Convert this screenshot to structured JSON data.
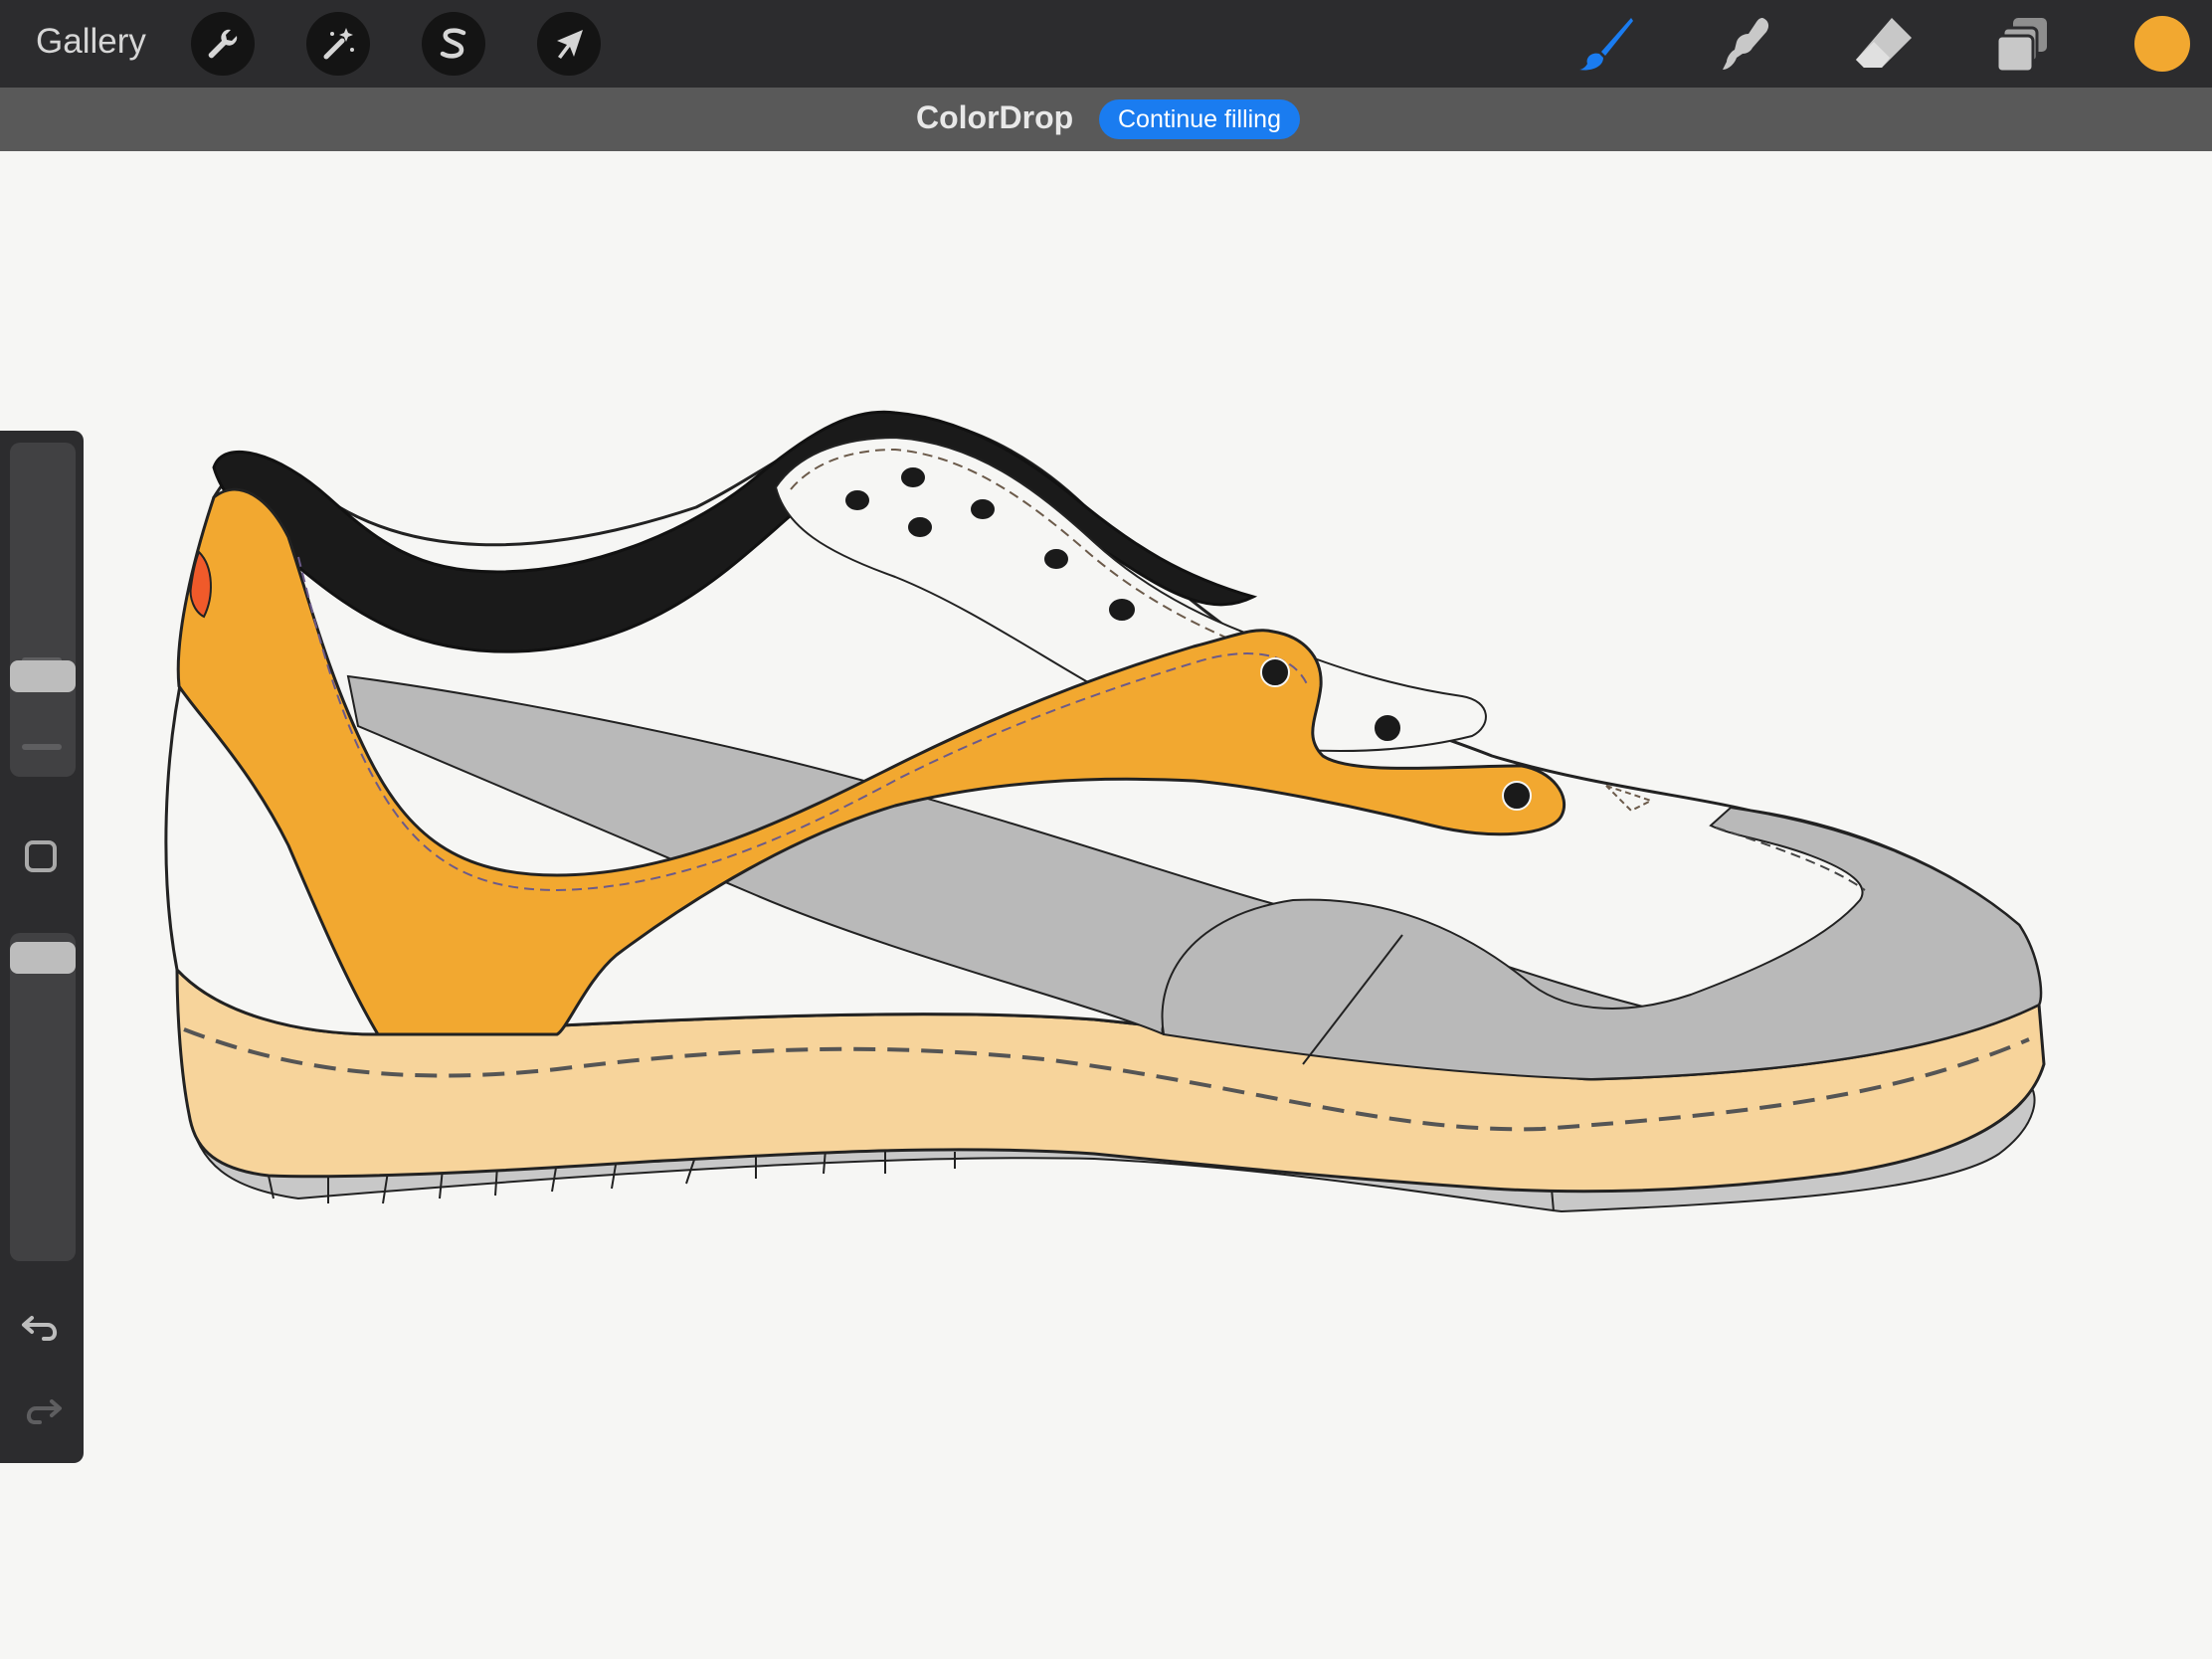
{
  "toolbar": {
    "gallery_label": "Gallery",
    "current_color": "#f2a830",
    "active_tool_color": "#1a7cf0"
  },
  "banner": {
    "title": "ColorDrop",
    "continue_label": "Continue filling",
    "button_color": "#1a7cf0"
  },
  "icons": {
    "actions": "wrench-icon",
    "adjustments": "magic-wand-icon",
    "selection": "selection-s-icon",
    "transform": "transform-arrow-icon",
    "brush": "brush-icon",
    "smudge": "smudge-icon",
    "eraser": "eraser-icon",
    "layers": "layers-icon",
    "undo": "undo-icon",
    "redo": "redo-icon"
  },
  "sidebar": {
    "brush_size": 0.28,
    "opacity": 0.97
  },
  "artwork": {
    "fill_orange": "#f2a830",
    "fill_gray": "#b9b9b9",
    "fill_sole": "#f7d49b",
    "fill_collar": "#1a1a1a",
    "fill_red": "#f05a2a"
  }
}
